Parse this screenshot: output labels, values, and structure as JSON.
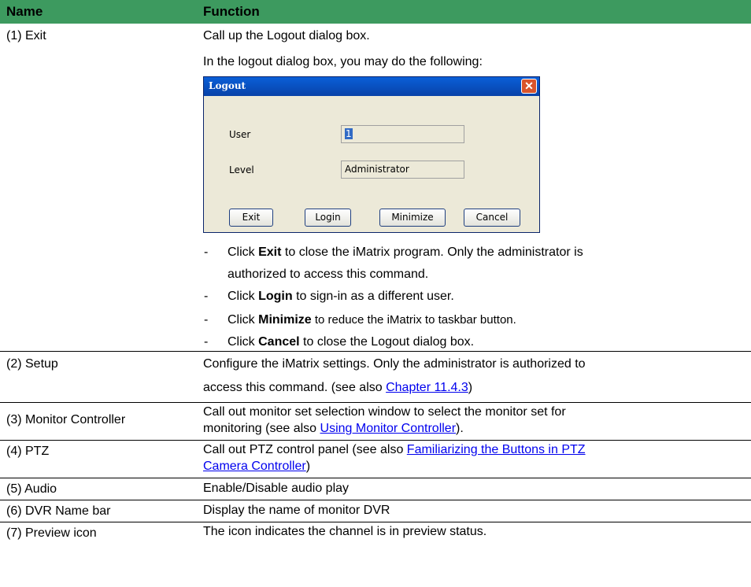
{
  "header": {
    "name": "Name",
    "function": "Function"
  },
  "exit": {
    "name": "(1) Exit",
    "line1": "Call up the Logout dialog box.",
    "line2": "In the logout dialog box, you may do the following:",
    "bullets": [
      {
        "pre": "Click ",
        "bold": "Exit",
        "post": " to close the iMatrix program. Only the administrator is"
      },
      {
        "cont": "authorized to access this command."
      },
      {
        "pre": "Click ",
        "bold": "Login",
        "post": " to sign-in as a different user."
      },
      {
        "pre": "Click ",
        "bold": "Minimize",
        "post": " to reduce the iMatrix to taskbar button."
      },
      {
        "pre": "Click ",
        "bold": "Cancel",
        "post": " to close the Logout dialog box."
      }
    ],
    "dash": "-"
  },
  "dialog": {
    "title": "Logout",
    "close": "✕",
    "user_label": "User",
    "user_value": "1",
    "level_label": "Level",
    "level_value": "Administrator",
    "buttons": {
      "exit": "Exit",
      "login": "Login",
      "minimize": "Minimize",
      "cancel": "Cancel"
    }
  },
  "setup": {
    "name": "(2) Setup",
    "line1": "Configure the iMatrix settings. Only the administrator is authorized to",
    "line2_pre": "access this command. (see also ",
    "line2_link": "Chapter 11.4.3",
    "line2_post": ")"
  },
  "monitor": {
    "name": "(3) Monitor Controller",
    "line1": "Call out monitor set selection window to select the monitor set for",
    "line2_pre": "monitoring (see also ",
    "line2_link": "Using Monitor Controller",
    "line2_post": ")."
  },
  "ptz": {
    "name": "(4) PTZ",
    "line1_pre": "Call out PTZ control panel (see also ",
    "line1_link": "Familiarizing the Buttons in PTZ ",
    "line2_link": "Camera Controller",
    "line2_post": ")"
  },
  "audio": {
    "name": "(5) Audio",
    "text": "Enable/Disable audio play"
  },
  "dvr": {
    "name": "(6) DVR Name bar",
    "text": "Display the name of monitor DVR"
  },
  "preview": {
    "name": "(7) Preview icon",
    "text": "The icon indicates the channel is in preview status."
  }
}
